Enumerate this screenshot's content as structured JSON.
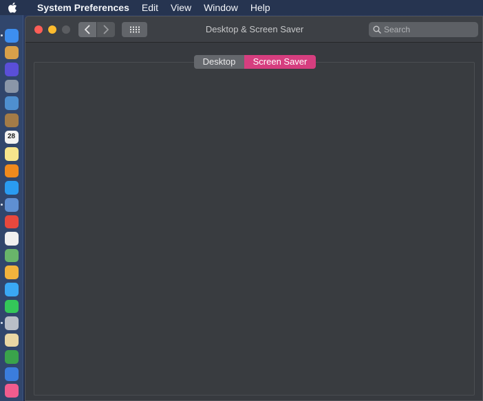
{
  "menubar": {
    "app_name": "System Preferences",
    "items": [
      "Edit",
      "View",
      "Window",
      "Help"
    ]
  },
  "dock": {
    "icons": [
      {
        "name": "finder-icon",
        "color": "#3d8ef0"
      },
      {
        "name": "automator-icon",
        "color": "#d8a04a"
      },
      {
        "name": "siri-icon",
        "color": "#5a4fd8"
      },
      {
        "name": "launchpad-icon",
        "color": "#8a96a8"
      },
      {
        "name": "preview-icon",
        "color": "#4f8fcf"
      },
      {
        "name": "notebook-icon",
        "color": "#a37b47"
      },
      {
        "name": "calendar-icon",
        "color": "#f2f2f2",
        "text": "28"
      },
      {
        "name": "notes-icon",
        "color": "#f7e58c"
      },
      {
        "name": "vlc-icon",
        "color": "#f08a1d"
      },
      {
        "name": "safari-icon",
        "color": "#2a9bf0"
      },
      {
        "name": "photo-slideshow-icon",
        "color": "#5f8fd2"
      },
      {
        "name": "chrome-icon",
        "color": "#e8483d"
      },
      {
        "name": "reminders-icon",
        "color": "#f0f0f0"
      },
      {
        "name": "maps-icon",
        "color": "#69b56a"
      },
      {
        "name": "photos-icon",
        "color": "#f2b33d"
      },
      {
        "name": "messages-icon",
        "color": "#3aa8f5"
      },
      {
        "name": "facetime-icon",
        "color": "#34c759"
      },
      {
        "name": "compressor-icon",
        "color": "#b9bec7"
      },
      {
        "name": "textedit-icon",
        "color": "#e9d7a4"
      },
      {
        "name": "numbers-icon",
        "color": "#3aa34b"
      },
      {
        "name": "keynote-icon",
        "color": "#3b7ddd"
      },
      {
        "name": "itunes-icon",
        "color": "#f05c8e"
      }
    ]
  },
  "window": {
    "title": "Desktop & Screen Saver",
    "search_placeholder": "Search",
    "tabs": [
      {
        "label": "Desktop",
        "selected": false
      },
      {
        "label": "Screen Saver",
        "selected": true
      }
    ],
    "accent_color": "#d63e7f"
  }
}
